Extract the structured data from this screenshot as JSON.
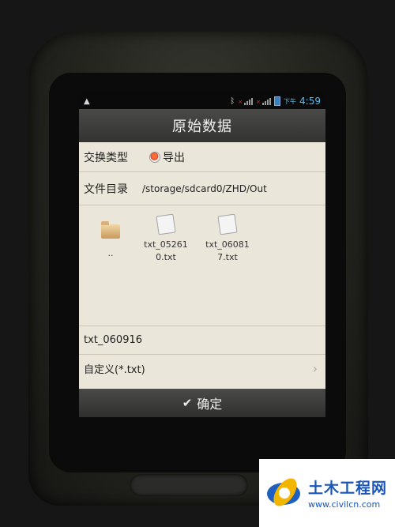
{
  "statusbar": {
    "ampm": "下午",
    "time": "4:59"
  },
  "header": {
    "title": "原始数据"
  },
  "exchange": {
    "label": "交换类型",
    "option": "导出"
  },
  "directory": {
    "label": "文件目录",
    "path": "/storage/sdcard0/ZHD/Out"
  },
  "files": [
    {
      "name": "..",
      "icon": "folder-icon"
    },
    {
      "name": "txt_052610.txt",
      "line1": "txt_05261",
      "line2": "0.txt",
      "icon": "text-file-icon"
    },
    {
      "name": "txt_060817.txt",
      "line1": "txt_06081",
      "line2": "7.txt",
      "icon": "text-file-icon"
    }
  ],
  "filename_input": {
    "value": "txt_060916"
  },
  "filter": {
    "label": "自定义(*.txt)"
  },
  "confirm": {
    "label": "确定"
  },
  "watermark": {
    "name": "土木工程网",
    "url": "www.civilcn.com"
  }
}
